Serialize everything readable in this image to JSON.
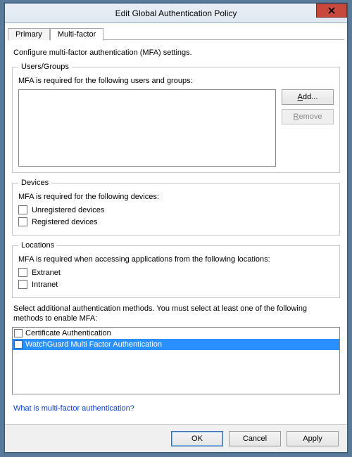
{
  "window": {
    "title": "Edit Global Authentication Policy"
  },
  "tabs": [
    {
      "label": "Primary",
      "active": false
    },
    {
      "label": "Multi-factor",
      "active": true
    }
  ],
  "intro": "Configure multi-factor authentication (MFA) settings.",
  "users_group": {
    "legend": "Users/Groups",
    "sublabel": "MFA is required for the following users and groups:",
    "add_label": "Add...",
    "remove_label": "Remove"
  },
  "devices_group": {
    "legend": "Devices",
    "sublabel": "MFA is required for the following devices:",
    "options": [
      {
        "label": "Unregistered devices",
        "checked": false
      },
      {
        "label": "Registered devices",
        "checked": false
      }
    ]
  },
  "locations_group": {
    "legend": "Locations",
    "sublabel": "MFA is required when accessing applications from the following locations:",
    "options": [
      {
        "label": "Extranet",
        "checked": false
      },
      {
        "label": "Intranet",
        "checked": false
      }
    ]
  },
  "methods": {
    "label": "Select additional authentication methods. You must select at least one of the following methods to enable MFA:",
    "items": [
      {
        "label": "Certificate Authentication",
        "checked": false,
        "selected": false
      },
      {
        "label": "WatchGuard Multi Factor Authentication",
        "checked": false,
        "selected": true
      }
    ]
  },
  "help_link": "What is multi-factor authentication?",
  "footer": {
    "ok": "OK",
    "cancel": "Cancel",
    "apply": "Apply"
  }
}
